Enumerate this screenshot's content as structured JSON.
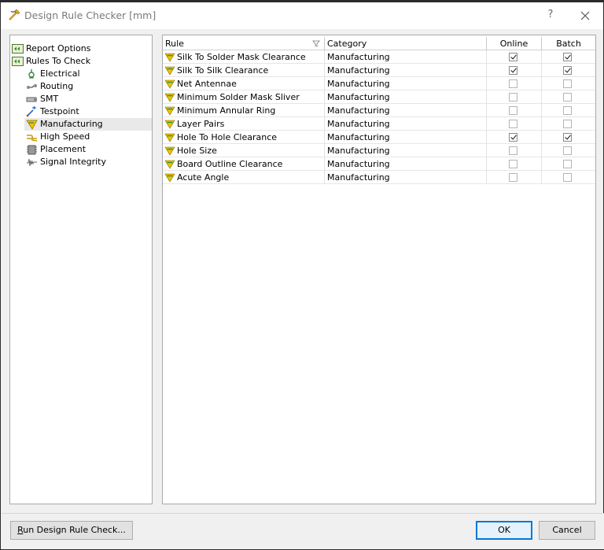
{
  "window": {
    "title": "Design Rule Checker [mm]",
    "help_label": "?"
  },
  "tree": [
    {
      "label": "Report Options",
      "icon": "report-options-icon",
      "level": 0
    },
    {
      "label": "Rules To Check",
      "icon": "rules-to-check-icon",
      "level": 0
    },
    {
      "label": "Electrical",
      "icon": "electrical-icon",
      "level": 1
    },
    {
      "label": "Routing",
      "icon": "routing-icon",
      "level": 1
    },
    {
      "label": "SMT",
      "icon": "smt-icon",
      "level": 1
    },
    {
      "label": "Testpoint",
      "icon": "testpoint-icon",
      "level": 1
    },
    {
      "label": "Manufacturing",
      "icon": "manufacturing-icon",
      "level": 1,
      "selected": true
    },
    {
      "label": "High Speed",
      "icon": "high-speed-icon",
      "level": 1
    },
    {
      "label": "Placement",
      "icon": "placement-icon",
      "level": 1
    },
    {
      "label": "Signal Integrity",
      "icon": "signal-integrity-icon",
      "level": 1
    }
  ],
  "table": {
    "columns": [
      "Rule",
      "Category",
      "Online",
      "Batch"
    ],
    "rows": [
      {
        "rule": "Silk To Solder Mask Clearance",
        "category": "Manufacturing",
        "online": true,
        "batch": true
      },
      {
        "rule": "Silk To Silk Clearance",
        "category": "Manufacturing",
        "online": true,
        "batch": true
      },
      {
        "rule": "Net Antennae",
        "category": "Manufacturing",
        "online": false,
        "batch": false
      },
      {
        "rule": "Minimum Solder Mask Sliver",
        "category": "Manufacturing",
        "online": false,
        "batch": false
      },
      {
        "rule": "Minimum Annular Ring",
        "category": "Manufacturing",
        "online": false,
        "batch": false
      },
      {
        "rule": "Layer Pairs",
        "category": "Manufacturing",
        "online": false,
        "batch": false
      },
      {
        "rule": "Hole To Hole Clearance",
        "category": "Manufacturing",
        "online": true,
        "batch": true
      },
      {
        "rule": "Hole Size",
        "category": "Manufacturing",
        "online": false,
        "batch": false
      },
      {
        "rule": "Board Outline Clearance",
        "category": "Manufacturing",
        "online": false,
        "batch": false
      },
      {
        "rule": "Acute Angle",
        "category": "Manufacturing",
        "online": false,
        "batch": false
      }
    ]
  },
  "buttons": {
    "run_prefix": "R",
    "run_rest": "un Design Rule Check...",
    "ok": "OK",
    "cancel": "Cancel"
  },
  "colors": {
    "accent": "#0078d7",
    "rule_icon_yellow": "#f2c200",
    "rule_icon_green": "#2e9b3c"
  }
}
